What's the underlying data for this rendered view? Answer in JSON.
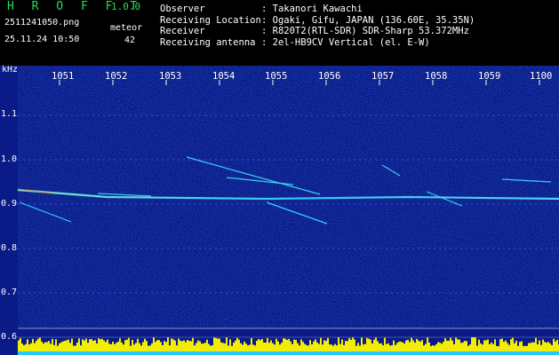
{
  "header": {
    "app_name": "H R O F F T",
    "version": "1.0.0",
    "filename": "2511241050.png",
    "datetime": "25.11.24 10:50",
    "meteor_label": "meteor",
    "meteor_count": "42",
    "info": [
      {
        "label": "Observer",
        "value": ": Takanori Kawachi"
      },
      {
        "label": "Receiving Location",
        "value": ": Ogaki, Gifu, JAPAN (136.60E, 35.35N)"
      },
      {
        "label": "Receiver",
        "value": ": R820T2(RTL-SDR) SDR-Sharp 53.372MHz"
      },
      {
        "label": "Receiving antenna",
        "value": ": 2el-HB9CV Vertical (el. E-W)"
      }
    ]
  },
  "axis": {
    "unit": "kHz",
    "y_ticks": [
      "1.1",
      "1.0",
      "0.9",
      "0.8",
      "0.7",
      "0.6"
    ],
    "x_ticks": [
      "1051",
      "1052",
      "1053",
      "1054",
      "1055",
      "1056",
      "1057",
      "1058",
      "1059",
      "1100"
    ]
  },
  "colors": {
    "background": "#0b1a8c",
    "title_green": "#22e05a",
    "carrier": "#2fd0ff",
    "meteor": "#40e0ff",
    "level_bar": "#f2ee00",
    "level_base": "#22c8ff"
  }
}
